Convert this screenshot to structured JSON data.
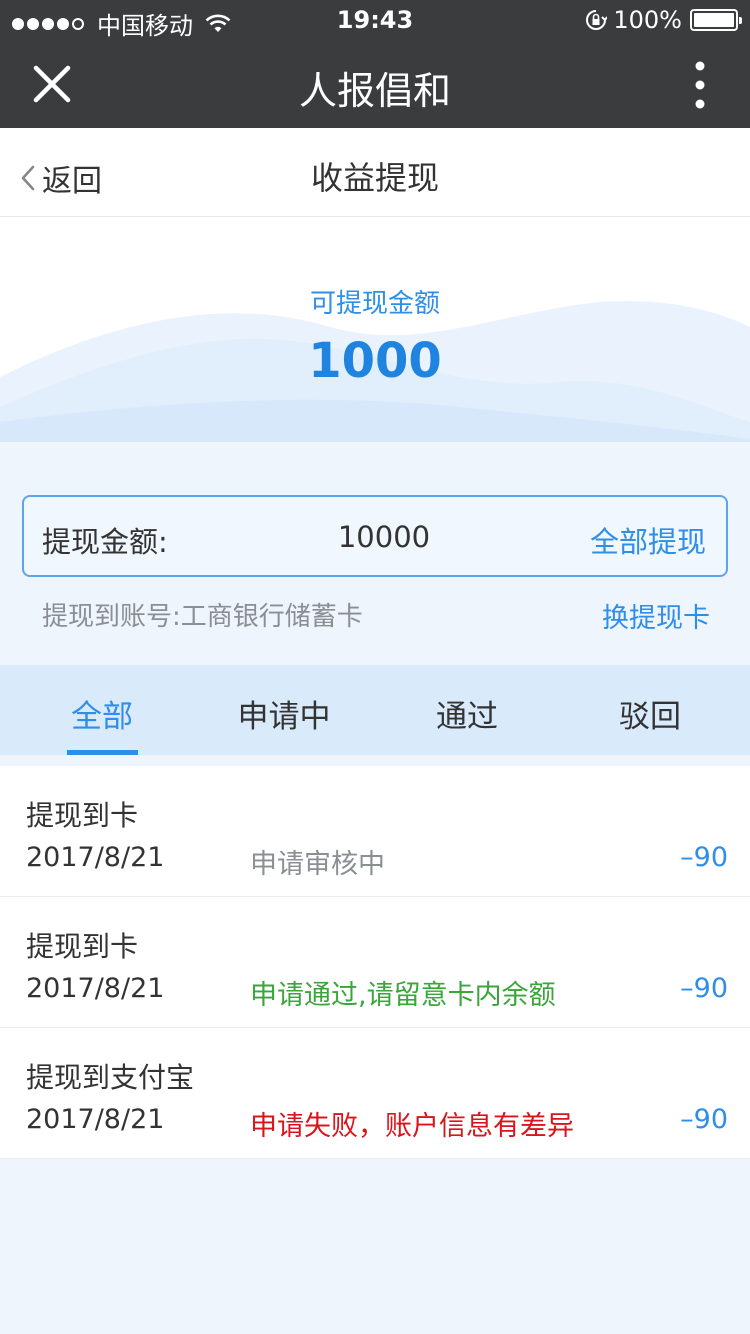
{
  "status_bar": {
    "carrier": "中国移动",
    "time": "19:43",
    "battery": "100%"
  },
  "title_bar": {
    "title": "人报倡和"
  },
  "nav_bar": {
    "back_label": "返回",
    "page_title": "收益提现"
  },
  "balance": {
    "label": "可提现金额",
    "amount": "1000"
  },
  "withdraw": {
    "amount_label": "提现金额:",
    "amount_value": "10000",
    "withdraw_all_label": "全部提现",
    "account_text": "提现到账号:工商银行储蓄卡",
    "change_card_label": "换提现卡"
  },
  "tabs": [
    {
      "label": "全部"
    },
    {
      "label": "申请中"
    },
    {
      "label": "通过"
    },
    {
      "label": "驳回"
    }
  ],
  "records": [
    {
      "title": "提现到卡",
      "date": "2017/8/21",
      "status": "申请审核中",
      "amount": "–90"
    },
    {
      "title": "提现到卡",
      "date": "2017/8/21",
      "status": "申请通过,请留意卡内余额",
      "amount": "–90"
    },
    {
      "title": "提现到支付宝",
      "date": "2017/8/21",
      "status": "申请失败，账户信息有差异",
      "amount": "–90"
    }
  ],
  "colors": {
    "accent": "#2e8ee8",
    "status_pending": "#8b8f94",
    "status_approved": "#3aa63a",
    "status_rejected": "#d9141b"
  }
}
